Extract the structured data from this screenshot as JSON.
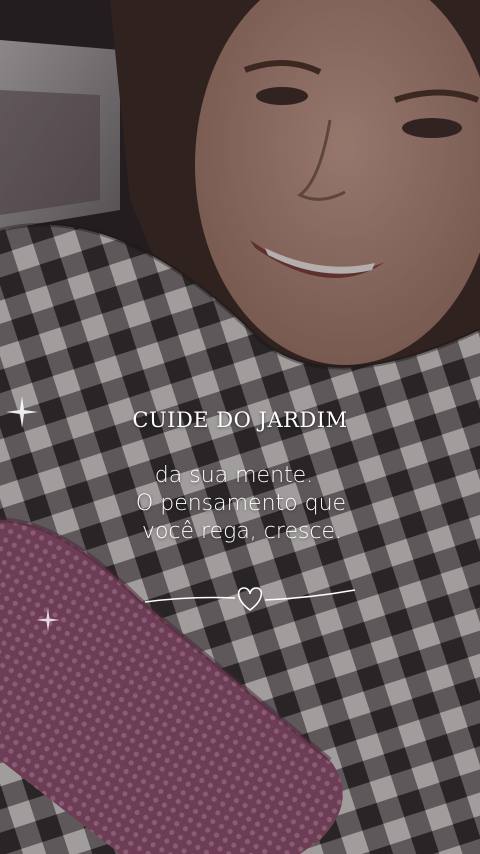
{
  "overlay_text": {
    "title": "CUIDE DO JARDIM",
    "lines": [
      "da sua mente.",
      "O pensamento que",
      "você rega, cresce."
    ]
  },
  "colors": {
    "text": "#ffffff",
    "seatbelt_pad": "#9a5a7a",
    "scarf_dark": "#2a2628",
    "scarf_light": "#dedad8"
  },
  "decorations": [
    "sparkle-icon",
    "heart-divider-icon"
  ]
}
